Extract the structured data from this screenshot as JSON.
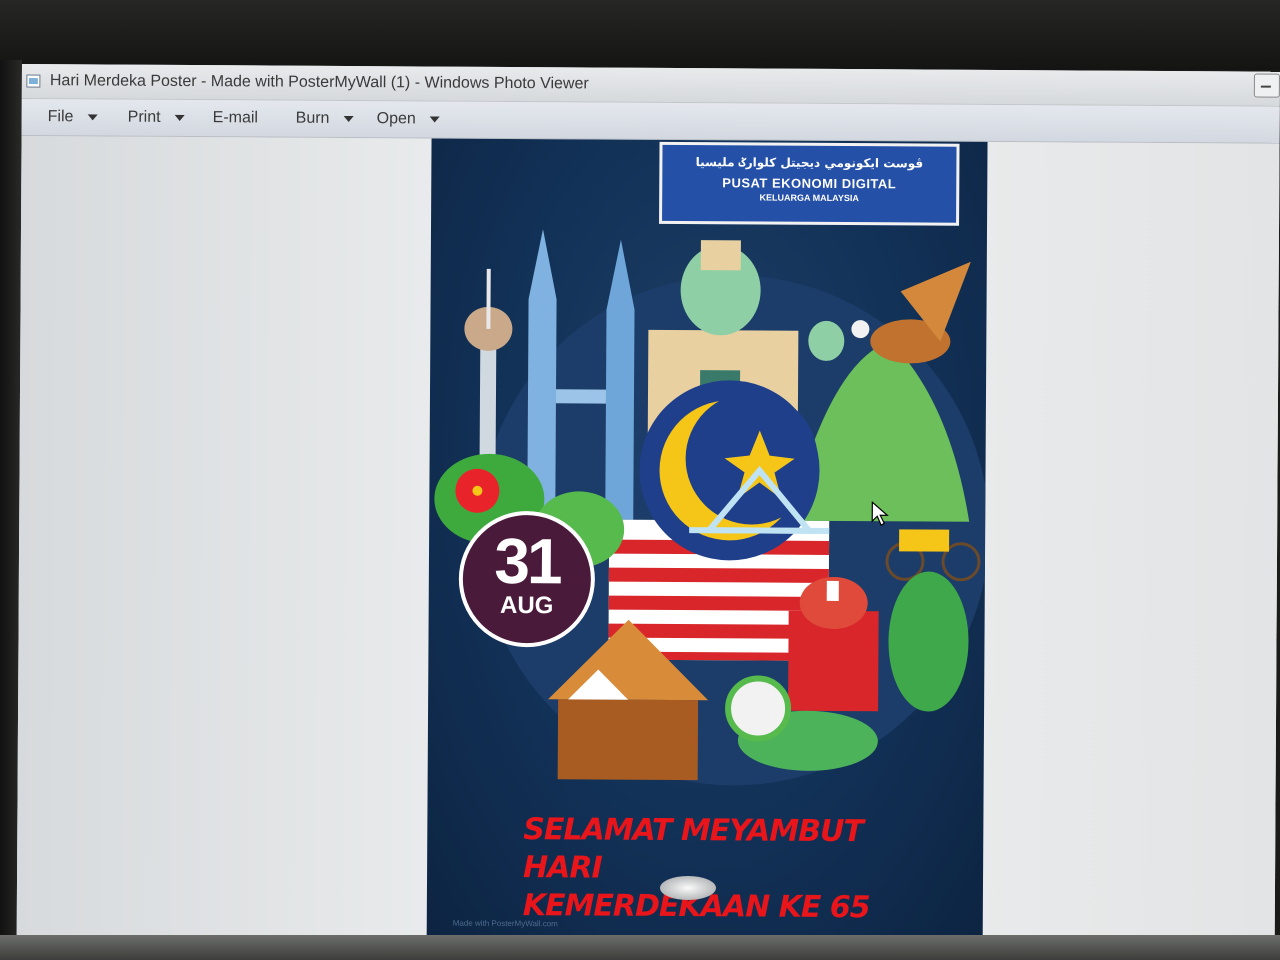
{
  "window": {
    "title": "Hari Merdeka Poster - Made with PosterMyWall (1) - Windows Photo Viewer",
    "app_icon": "photo-viewer-icon"
  },
  "menu": [
    {
      "label": "File",
      "has_dropdown": true
    },
    {
      "label": "Print",
      "has_dropdown": true
    },
    {
      "label": "E-mail",
      "has_dropdown": false
    },
    {
      "label": "Burn",
      "has_dropdown": true
    },
    {
      "label": "Open",
      "has_dropdown": true
    }
  ],
  "poster": {
    "banner": {
      "jawi": "ڤوست ايکونومي ديجيتل کلوارݢ مليسيا",
      "title": "PUSAT EKONOMI DIGITAL",
      "subtitle": "KELUARGA MALAYSIA"
    },
    "date": {
      "day": "31",
      "month": "AUG"
    },
    "greeting_line1": "SELAMAT MEYAMBUT HARI",
    "greeting_line2": "KEMERDEKAAN KE 65",
    "watermark": "Made with PosterMyWall.com"
  },
  "colors": {
    "poster_bg": "#123157",
    "greeting_text": "#e8151b",
    "banner_bg": "#2550a8",
    "badge_bg": "#4a1a3a"
  }
}
